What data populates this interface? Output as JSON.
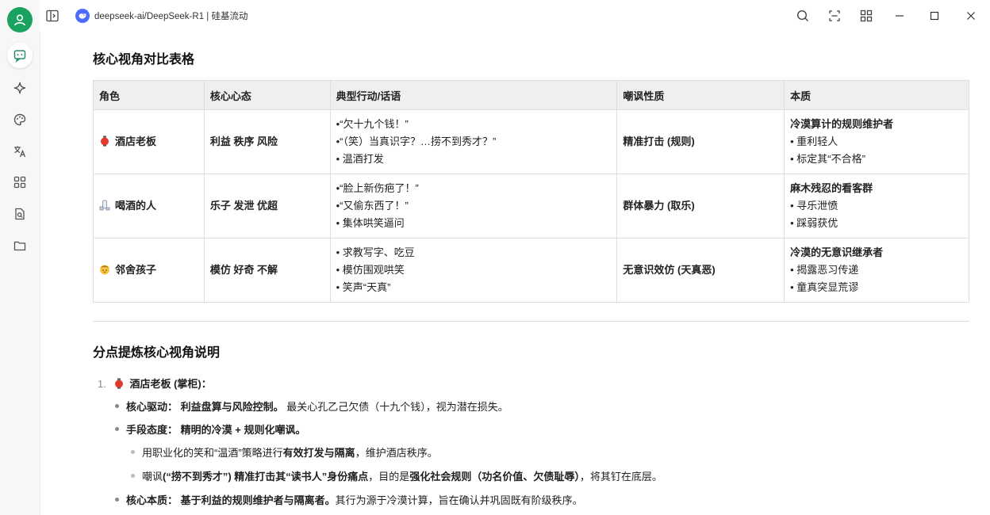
{
  "window": {
    "title": "deepseek-ai/DeepSeek-R1 | 硅基流动"
  },
  "rail": {
    "items": [
      {
        "icon": "chat-icon",
        "active": true
      },
      {
        "icon": "sparkle-icon"
      },
      {
        "icon": "palette-icon"
      },
      {
        "icon": "translate-icon"
      },
      {
        "icon": "apps-icon"
      },
      {
        "icon": "document-search-icon"
      },
      {
        "icon": "folder-icon"
      }
    ]
  },
  "section1": {
    "title": "核心视角对比表格"
  },
  "table": {
    "headers": [
      "角色",
      "核心心态",
      "典型行动/话语",
      "嘲讽性质",
      "本质"
    ],
    "rows": [
      {
        "emoji": "lantern-icon",
        "role": "酒店老板",
        "mindset": "利益 秩序 风险",
        "actions": [
          "•“欠十九个钱！”",
          "•“（笑）当真识字？…捞不到秀才？”",
          "• 温酒打发"
        ],
        "mockery": "精准打击 (规则)",
        "essence_title": "冷漠算计的规则维护者",
        "essence": [
          "• 重利轻人",
          "• 标定其“不合格”"
        ]
      },
      {
        "emoji": "sake-icon",
        "role": "喝酒的人",
        "mindset": "乐子 发泄 优超",
        "actions": [
          "•“脸上新伤疤了！”",
          "•“又偷东西了！”",
          "• 集体哄笑逼问"
        ],
        "mockery": "群体暴力 (取乐)",
        "essence_title": "麻木残忍的看客群",
        "essence": [
          "• 寻乐泄愤",
          "• 踩弱获优"
        ]
      },
      {
        "emoji": "child-icon",
        "role": "邻舍孩子",
        "mindset": "模仿 好奇 不解",
        "actions": [
          "• 求教写字、吃豆",
          "• 模仿围观哄笑",
          "• 笑声“天真”"
        ],
        "mockery": "无意识效仿 (天真恶)",
        "essence_title": "冷漠的无意识继承者",
        "essence": [
          "• 揭露恶习传递",
          "• 童真突显荒谬"
        ]
      }
    ]
  },
  "section2": {
    "title": "分点提炼核心视角说明"
  },
  "list": {
    "item1": {
      "number": "1.",
      "title": "酒店老板 (掌柜)：",
      "drive_label": "核心驱动：",
      "drive_bold": "利益盘算与风险控制。",
      "drive_rest": "最关心孔乙己欠债（十九个钱），视为潜在损失。",
      "attitude_label": "手段态度：",
      "attitude_bold": "精明的冷漠 + 规则化嘲讽。",
      "sub1_a": "用职业化的笑和“温酒”策略进行",
      "sub1_b": "有效打发与隔离",
      "sub1_c": "，维护酒店秩序。",
      "sub2_a": "嘲讽",
      "sub2_b": "(“捞不到秀才”) 精准打击其“读书人”身份痛点",
      "sub2_c": "，目的是",
      "sub2_d": "强化社会规则（功名价值、欠债耻辱）",
      "sub2_e": "，将其钉在底层。",
      "essence_label": "核心本质：",
      "essence_bold": "基于利益的规则维护者与隔离者。",
      "essence_rest": "其行为源于冷漠计算，旨在确认并巩固既有阶级秩序。"
    }
  }
}
